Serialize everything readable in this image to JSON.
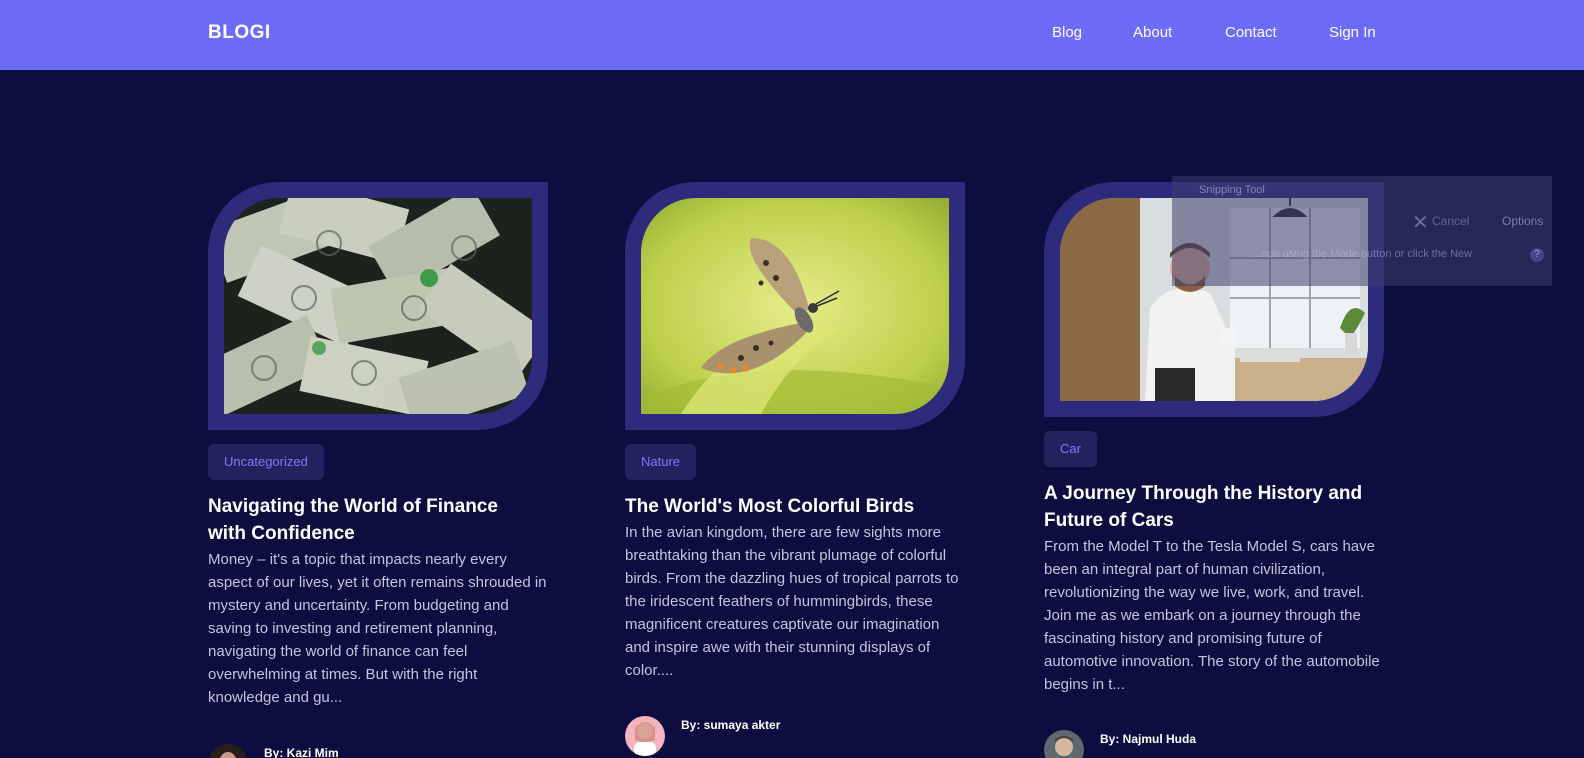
{
  "nav": {
    "logo": "BLOGI",
    "links": [
      "Blog",
      "About",
      "Contact",
      "Sign In"
    ]
  },
  "posts": [
    {
      "category": "Uncategorized",
      "title": "Navigating the World of Finance with Confidence",
      "excerpt": "Money – it's a topic that impacts nearly every aspect of our lives, yet it often remains shrouded in mystery and uncertainty. From budgeting and saving to investing and retirement planning, navigating the world of finance can feel overwhelming at times. But with the right knowledge and gu...",
      "author": "By: Kazi Mim"
    },
    {
      "category": "Nature",
      "title": "The World's Most Colorful Birds",
      "excerpt": "In the avian kingdom, there are few sights more breathtaking than the vibrant plumage of colorful birds. From the dazzling hues of tropical parrots to the iridescent feathers of hummingbirds, these magnificent creatures captivate our imagination and inspire awe with their stunning displays of color....",
      "author": "By: sumaya akter"
    },
    {
      "category": "Car",
      "title": "A Journey Through the History and Future of Cars",
      "excerpt": "From the Model T to the Tesla Model S, cars have been an integral part of human civilization, revolutionizing the way we live, work, and travel. Join me as we embark on a journey through the fascinating history and promising future of automotive innovation. The story of the automobile begins in t...",
      "author": "By: Najmul Huda"
    }
  ],
  "snipping_tool": {
    "title": "Snipping Tool",
    "cancel": "Cancel",
    "options": "Options",
    "hint": "...ode using the Mode button or click the New"
  },
  "colors": {
    "nav_bg": "#6c6cf7",
    "page_bg": "#0d0d3f",
    "frame": "#2d2b7c",
    "badge_bg": "#24225e",
    "badge_text": "#7b7bf9"
  }
}
